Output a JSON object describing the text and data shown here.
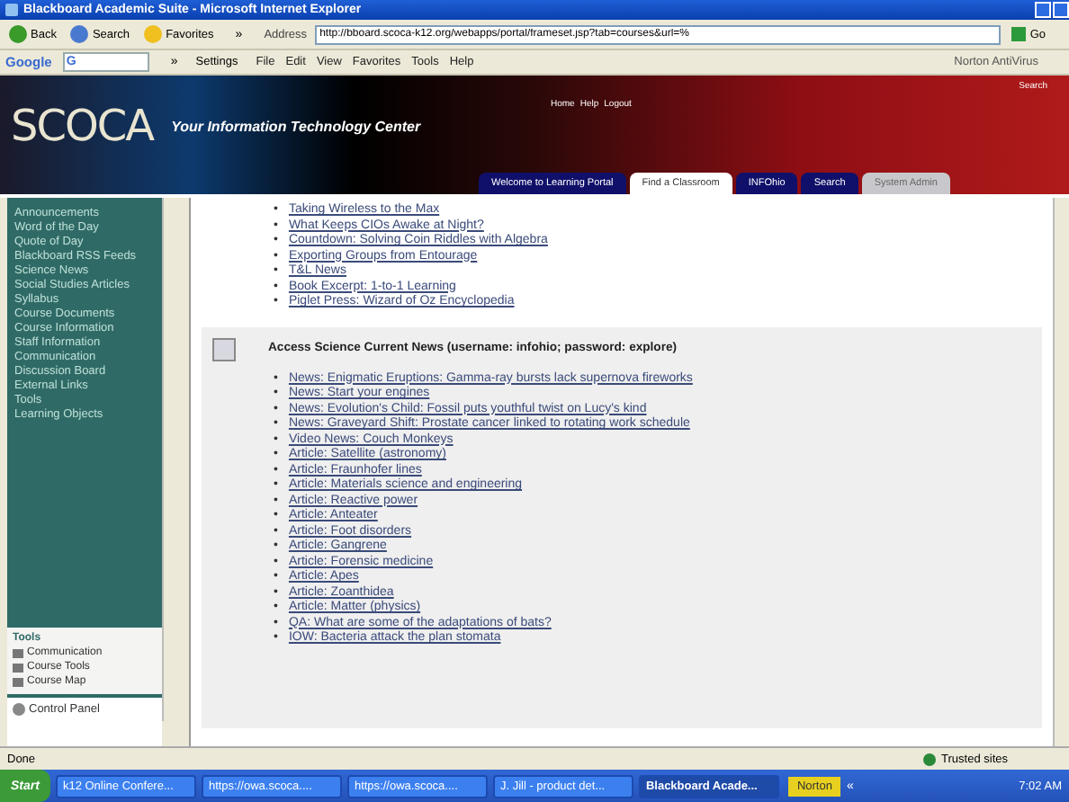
{
  "window": {
    "title": "Blackboard Academic Suite - Microsoft Internet Explorer"
  },
  "toolbar": {
    "buttons": [
      "Back",
      "Search",
      "Favorites"
    ],
    "chevron": "»",
    "address_label": "Address",
    "address": "http://bboard.scoca-k12.org/webapps/portal/frameset.jsp?tab=courses&url=%",
    "go": "Go"
  },
  "google_bar": {
    "logo": "Google",
    "search_prefix": "G",
    "chevron": "»",
    "settings": "Settings",
    "menu": [
      "File",
      "Edit",
      "View",
      "Favorites",
      "Tools",
      "Help"
    ],
    "norton": "Norton AntiVirus"
  },
  "banner": {
    "logo": "SCOCA",
    "tagline": "Your Information Technology Center",
    "nav": [
      "Home",
      "Help",
      "Logout"
    ],
    "search_link": "Search",
    "tabs": [
      {
        "label": "Welcome to Learning Portal",
        "selected": false,
        "disabled": false
      },
      {
        "label": "Find a Classroom",
        "selected": true,
        "disabled": false
      },
      {
        "label": "INFOhio",
        "selected": false,
        "disabled": false
      },
      {
        "label": "Search",
        "selected": false,
        "disabled": false
      },
      {
        "label": "System Admin",
        "selected": false,
        "disabled": true
      }
    ]
  },
  "sidebar": {
    "items": [
      "Announcements",
      "Word of the Day",
      "Quote of Day",
      "Blackboard RSS Feeds",
      "Science News",
      "Social Studies Articles",
      "Syllabus",
      "Course Documents",
      "Course Information",
      "Staff Information",
      "Communication",
      "Discussion Board",
      "External Links",
      "Tools",
      "Learning Objects"
    ],
    "tools_title": "Tools",
    "tools": [
      "Communication",
      "Course Tools",
      "Course Map"
    ],
    "control_panel": "Control Panel"
  },
  "content": {
    "bullet": "•",
    "links_top": [
      "Taking Wireless to the Max",
      "What Keeps CIOs Awake at Night?",
      "Countdown: Solving Coin Riddles with Algebra",
      "Exporting Groups from Entourage",
      "T&L News",
      "Book Excerpt: 1-to-1 Learning",
      "Piglet Press: Wizard of Oz Encyclopedia"
    ],
    "section_title": "Access Science Current News (username: infohio; password: explore)",
    "links": [
      "News: Enigmatic Eruptions: Gamma-ray bursts lack supernova fireworks",
      "News: Start your engines",
      "News: Evolution's Child: Fossil puts youthful twist on Lucy's kind",
      "News: Graveyard Shift: Prostate cancer linked to rotating work schedule",
      "Video News: Couch Monkeys",
      "Article: Satellite (astronomy)",
      "Article: Fraunhofer lines",
      "Article: Materials science and engineering",
      "Article: Reactive power",
      "Article: Anteater",
      "Article: Foot disorders",
      "Article: Gangrene",
      "Article: Forensic medicine",
      "Article: Apes",
      "Article: Zoanthidea",
      "Article: Matter (physics)",
      "QA: What are some of the adaptations of bats?",
      "IOW: Bacteria attack the plan stomata"
    ]
  },
  "status_bar": {
    "text": "Done",
    "zone": "Trusted sites"
  },
  "taskbar": {
    "start": "Start",
    "tasks": [
      {
        "label": "k12 Online Confere...",
        "selected": false
      },
      {
        "label": "https://owa.scoca....",
        "selected": false
      },
      {
        "label": "https://owa.scoca....",
        "selected": false
      },
      {
        "label": "J. Jill - product det...",
        "selected": false
      },
      {
        "label": "Blackboard Acade...",
        "selected": true
      }
    ],
    "tray": "Norton",
    "tray_chevron": "«",
    "clock": "7:02 AM"
  }
}
